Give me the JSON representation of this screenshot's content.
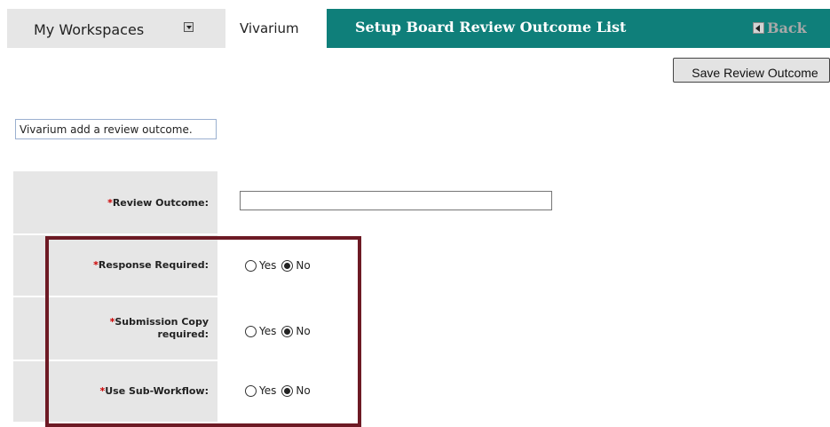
{
  "nav": {
    "workspaces_label": "My Workspaces",
    "vivarium_tab": "Vivarium",
    "title": "Setup Board Review Outcome List",
    "back_label": "Back"
  },
  "toolbar": {
    "save_label": "Save Review Outcome"
  },
  "info_text": "Vivarium add a review outcome.",
  "form": {
    "required_marker": "*",
    "review_outcome": {
      "label": "Review Outcome:",
      "value": ""
    },
    "response_required": {
      "label": "Response Required:",
      "selected": "No"
    },
    "submission_copy": {
      "label_line1": "Submission Copy",
      "label_line2": "required:",
      "selected": "No"
    },
    "use_sub_workflow": {
      "label": "Use Sub-Workflow:",
      "selected": "No"
    },
    "yes_label": "Yes",
    "no_label": "No"
  },
  "colors": {
    "title_bar": "#0f7f7a",
    "highlight_border": "#6d1a24",
    "required_star": "#cc0000"
  }
}
